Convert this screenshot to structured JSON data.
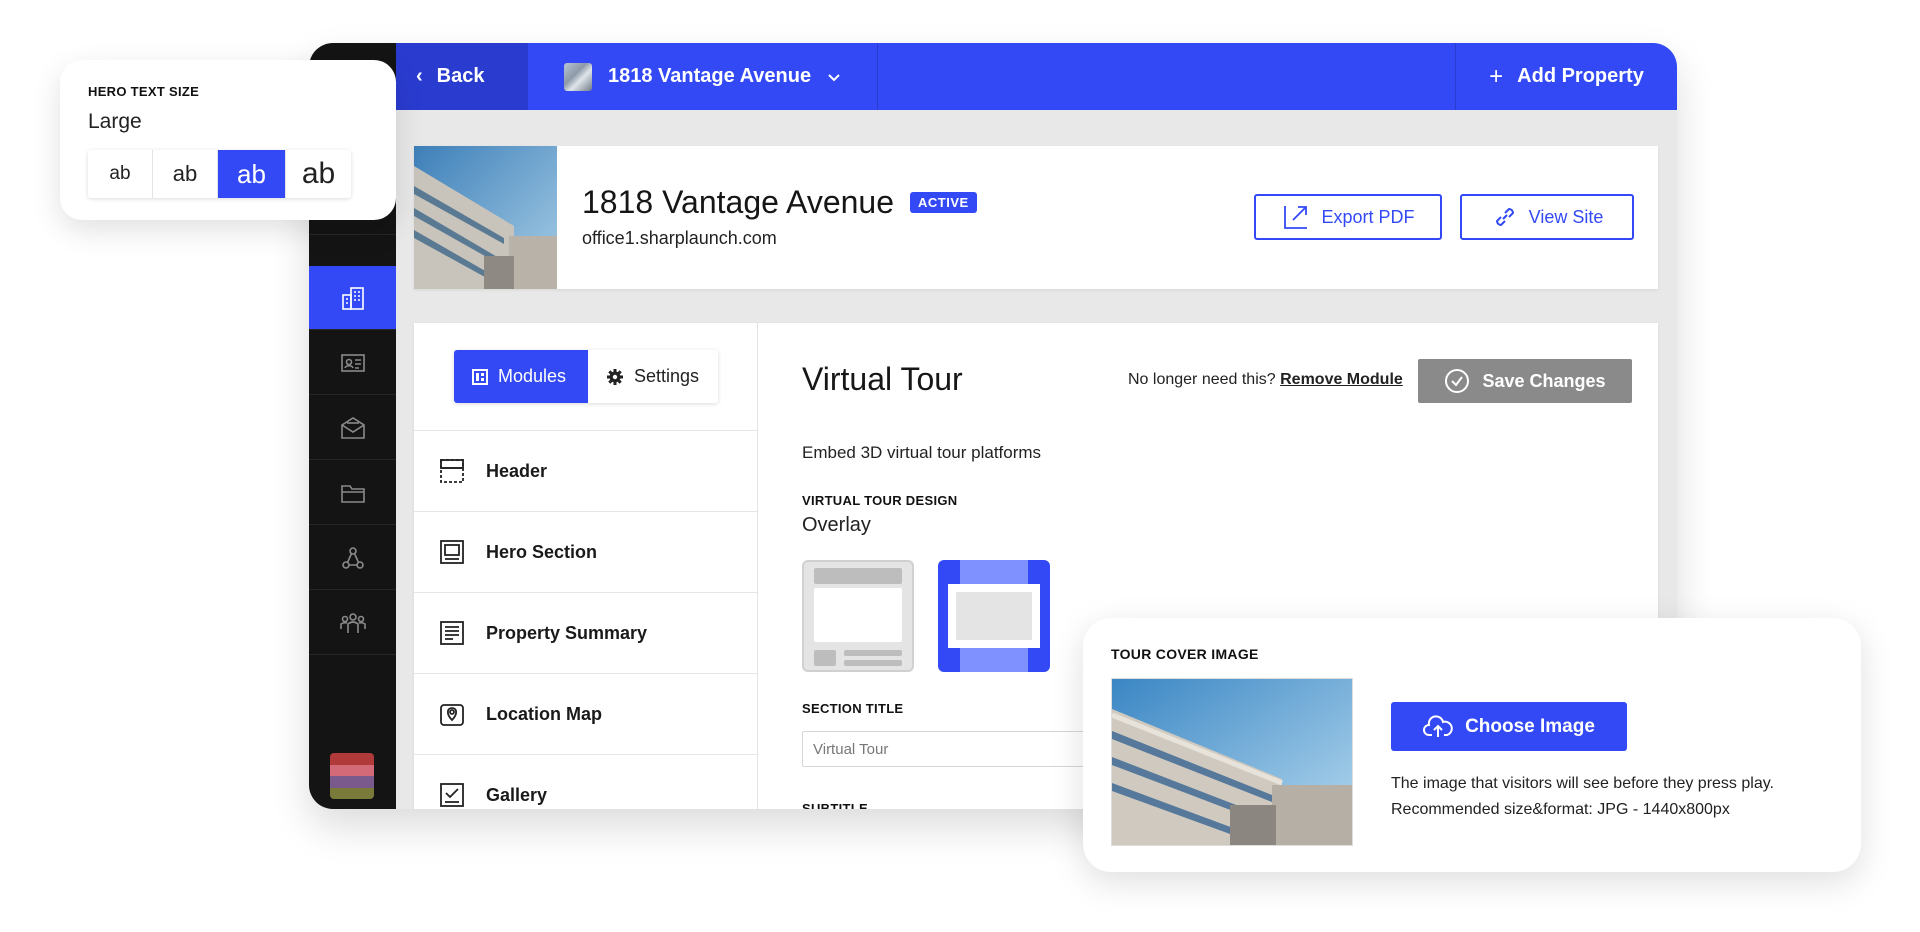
{
  "colors": {
    "accent": "#3349f5",
    "sidebar": "#141414",
    "save_disabled": "#8a8a8a"
  },
  "topbar": {
    "back_label": "Back",
    "property_name": "1818 Vantage Avenue",
    "add_property_label": "Add Property"
  },
  "sidebar": {
    "items": [
      {
        "icon": "trending-icon"
      },
      {
        "icon": "buildings-icon",
        "active": true
      },
      {
        "icon": "contact-card-icon"
      },
      {
        "icon": "mail-icon"
      },
      {
        "icon": "folder-icon"
      },
      {
        "icon": "network-icon"
      },
      {
        "icon": "team-icon"
      }
    ]
  },
  "property": {
    "title": "1818 Vantage Avenue",
    "status": "ACTIVE",
    "url": "office1.sharplaunch.com",
    "export_label": "Export PDF",
    "view_site_label": "View Site"
  },
  "editor": {
    "tabs": {
      "modules": "Modules",
      "settings": "Settings"
    },
    "modules": [
      {
        "label": "Header",
        "icon": "header-module-icon"
      },
      {
        "label": "Hero Section",
        "icon": "hero-module-icon"
      },
      {
        "label": "Property Summary",
        "icon": "summary-module-icon"
      },
      {
        "label": "Location Map",
        "icon": "map-module-icon"
      },
      {
        "label": "Gallery",
        "icon": "gallery-module-icon"
      }
    ],
    "detail": {
      "title": "Virtual Tour",
      "remove_prompt": "No longer need this?",
      "remove_link": "Remove Module",
      "save_label": "Save Changes",
      "description": "Embed 3D virtual tour platforms",
      "design_label": "VIRTUAL TOUR DESIGN",
      "design_value": "Overlay",
      "section_title_label": "SECTION TITLE",
      "section_title_value": "Virtual Tour",
      "subtitle_label": "SUBTITLE"
    }
  },
  "hero_text_size": {
    "label": "HERO TEXT SIZE",
    "value": "Large",
    "options": [
      "ab",
      "ab",
      "ab",
      "ab"
    ]
  },
  "tour_cover": {
    "label": "TOUR COVER IMAGE",
    "button_label": "Choose Image",
    "help_line1": "The image that visitors will see before they press play.",
    "help_line2": "Recommended size&format: JPG - 1440x800px"
  }
}
